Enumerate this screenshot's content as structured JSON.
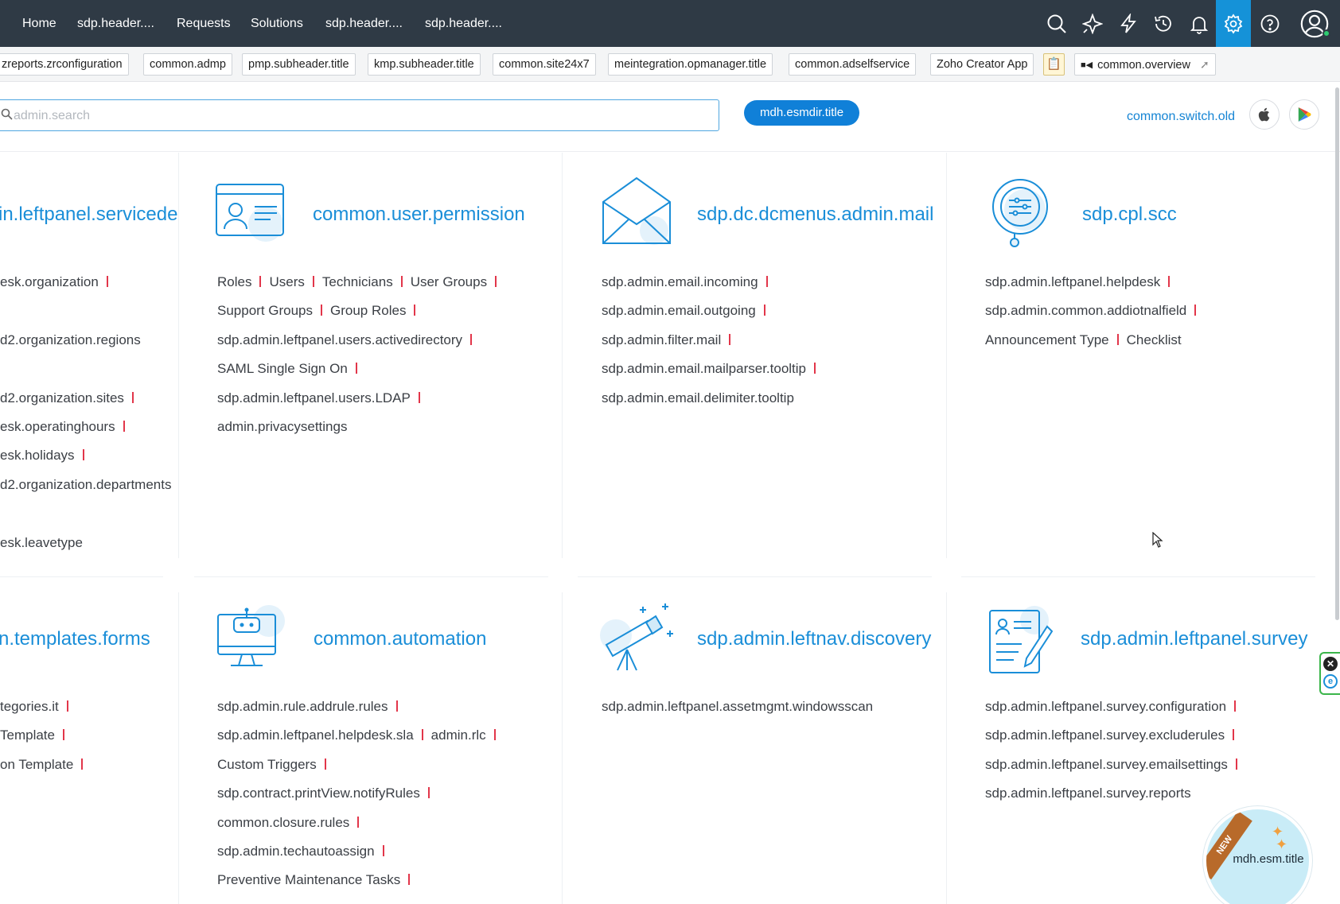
{
  "nav": {
    "items": [
      "Home",
      "sdp.header....",
      "Requests",
      "Solutions",
      "sdp.header....",
      "sdp.header...."
    ],
    "icons": [
      "search-icon",
      "zia-icon",
      "lightning-icon",
      "history-icon",
      "bell-icon",
      "gear-icon",
      "help-icon",
      "user-avatar-icon"
    ]
  },
  "subheader": {
    "chips": [
      "zreports.zrconfiguration",
      "common.admp",
      "pmp.subheader.title",
      "kmp.subheader.title",
      "common.site24x7",
      "meintegration.opmanager.title",
      "common.adselfservice",
      "Zoho Creator App"
    ],
    "overview": "common.overview"
  },
  "search": {
    "placeholder": "admin.search",
    "esm_button": "mdh.esmdir.title",
    "switch_old": "common.switch.old"
  },
  "cards": {
    "servicedesk": {
      "title": "in.leftpanel.servicedesk",
      "links": [
        "esk.organization",
        "d2.organization.regions",
        "d2.organization.sites",
        "esk.operatinghours",
        "esk.holidays",
        "d2.organization.departments",
        "esk.leavetype"
      ]
    },
    "user_permission": {
      "title": "common.user.permission",
      "links": [
        "Roles",
        "Users",
        "Technicians",
        "User Groups",
        "Support Groups",
        "Group Roles",
        "sdp.admin.leftpanel.users.activedirectory",
        "SAML Single Sign On",
        "sdp.admin.leftpanel.users.LDAP",
        "admin.privacysettings"
      ]
    },
    "mail": {
      "title": "sdp.dc.dcmenus.admin.mail",
      "links": [
        "sdp.admin.email.incoming",
        "sdp.admin.email.outgoing",
        "sdp.admin.filter.mail",
        "sdp.admin.email.mailparser.tooltip",
        "sdp.admin.email.delimiter.tooltip"
      ]
    },
    "scc": {
      "title": "sdp.cpl.scc",
      "links": [
        "sdp.admin.leftpanel.helpdesk",
        "sdp.admin.common.addiotnalfield",
        "Announcement Type",
        "Checklist"
      ]
    },
    "templates": {
      "title": "n.templates.forms",
      "links": [
        "tegories.it",
        "Template",
        "on Template"
      ]
    },
    "automation": {
      "title": "common.automation",
      "links": [
        "sdp.admin.rule.addrule.rules",
        "sdp.admin.leftpanel.helpdesk.sla",
        "admin.rlc",
        "Custom Triggers",
        "sdp.contract.printView.notifyRules",
        "common.closure.rules",
        "sdp.admin.techautoassign",
        "Preventive Maintenance Tasks"
      ]
    },
    "discovery": {
      "title": "sdp.admin.leftnav.discovery",
      "links": [
        "sdp.admin.leftpanel.assetmgmt.windowsscan"
      ]
    },
    "survey": {
      "title": "sdp.admin.leftpanel.survey",
      "links": [
        "sdp.admin.leftpanel.survey.configuration",
        "sdp.admin.leftpanel.survey.excluderules",
        "sdp.admin.leftpanel.survey.emailsettings",
        "sdp.admin.leftpanel.survey.reports"
      ]
    }
  },
  "bubble": {
    "badge": "NEW",
    "label": "mdh.esm.title"
  },
  "colors": {
    "nav_bg": "#2f3a45",
    "accent": "#1592d8",
    "title_blue": "#1a8ed8",
    "separator_red": "#e2364a"
  }
}
